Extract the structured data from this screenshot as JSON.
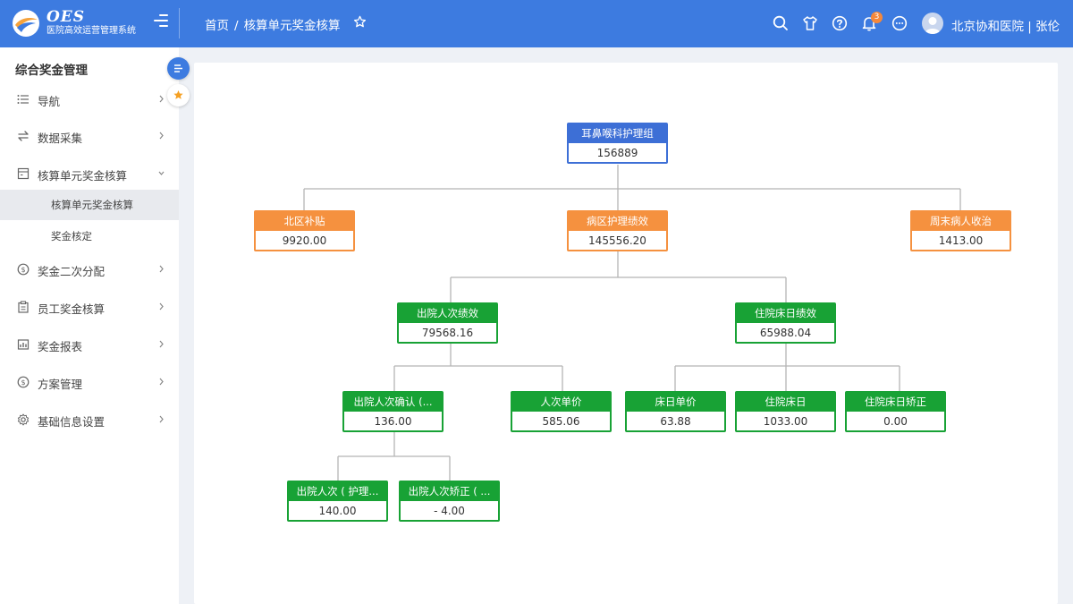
{
  "header": {
    "brand_name": "OES",
    "brand_subtitle": "医院高效运营管理系统",
    "breadcrumb_home": "首页",
    "breadcrumb_sep": "/",
    "breadcrumb_current": "核算单元奖金核算",
    "notification_count": "3",
    "user_label": "北京协和医院 | 张伦",
    "icons": [
      "search-icon",
      "shirt-icon",
      "help-icon",
      "bell-icon",
      "chat-icon"
    ]
  },
  "sidebar": {
    "title": "综合奖金管理",
    "items": [
      {
        "label": "导航",
        "icon": "list-icon"
      },
      {
        "label": "数据采集",
        "icon": "exchange-icon"
      },
      {
        "label": "核算单元奖金核算",
        "icon": "calculator-icon"
      },
      {
        "label": "奖金二次分配",
        "icon": "dollar-icon"
      },
      {
        "label": "员工奖金核算",
        "icon": "clipboard-icon"
      },
      {
        "label": "奖金报表",
        "icon": "report-icon"
      },
      {
        "label": "方案管理",
        "icon": "dollar-icon"
      },
      {
        "label": "基础信息设置",
        "icon": "gear-icon"
      }
    ],
    "subitems": [
      {
        "label": "核算单元奖金核算",
        "active": true
      },
      {
        "label": "奖金核定",
        "active": false
      }
    ]
  },
  "tree": {
    "root": {
      "title": "耳鼻喉科护理组",
      "value": "156889"
    },
    "level1": [
      {
        "title": "北区补贴",
        "value": "9920.00"
      },
      {
        "title": "病区护理绩效",
        "value": "145556.20"
      },
      {
        "title": "周末病人收治",
        "value": "1413.00"
      }
    ],
    "level2": [
      {
        "title": "出院人次绩效",
        "value": "79568.16"
      },
      {
        "title": "住院床日绩效",
        "value": "65988.04"
      }
    ],
    "level3": [
      {
        "title": "出院人次确认 (...",
        "value": "136.00"
      },
      {
        "title": "人次单价",
        "value": "585.06"
      },
      {
        "title": "床日单价",
        "value": "63.88"
      },
      {
        "title": "住院床日",
        "value": "1033.00"
      },
      {
        "title": "住院床日矫正",
        "value": "0.00"
      }
    ],
    "level4": [
      {
        "title": "出院人次 ( 护理...",
        "value": "140.00"
      },
      {
        "title": "出院人次矫正 ( ...",
        "value": "- 4.00"
      }
    ]
  },
  "colors": {
    "header": "#3d7be0",
    "root_node": "#3d6fd6",
    "orange_node": "#f5913f",
    "green_node": "#18a235",
    "connector": "#b5b5b5"
  }
}
